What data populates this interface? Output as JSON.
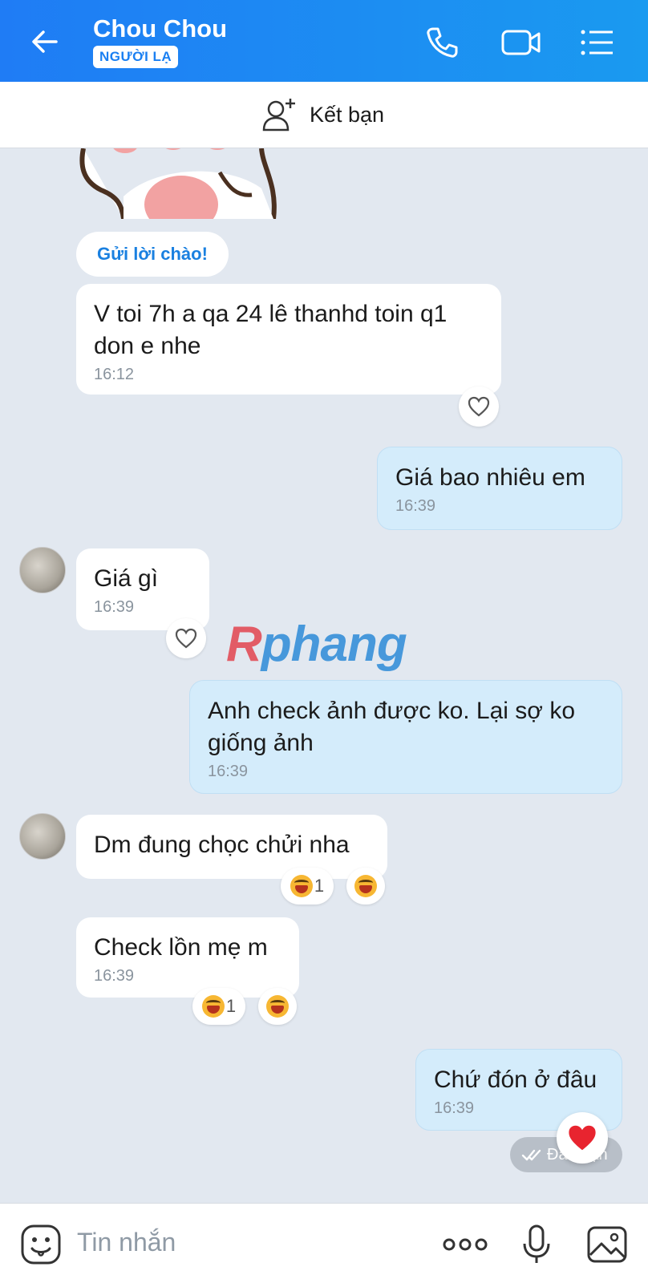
{
  "header": {
    "title": "Chou Chou",
    "badge": "NGƯỜI LẠ"
  },
  "add_friend": {
    "label": "Kết bạn"
  },
  "greeting_button": "Gửi lời chào!",
  "messages": [
    {
      "dir": "in",
      "text": "V toi 7h a qa 24 lê thanhd toin q1 don e nhe",
      "time": "16:12"
    },
    {
      "dir": "out",
      "text": "Giá bao nhiêu em",
      "time": "16:39"
    },
    {
      "dir": "in",
      "text": "Giá gì",
      "time": "16:39"
    },
    {
      "dir": "out",
      "text": "Anh check ảnh được ko. Lại sợ ko giống ảnh",
      "time": "16:39"
    },
    {
      "dir": "in",
      "text": "Dm đung chọc chửi nha",
      "time": "",
      "reaction_count": "1"
    },
    {
      "dir": "in",
      "text": "Check lồn mẹ m",
      "time": "16:39",
      "reaction_count": "1"
    },
    {
      "dir": "out",
      "text": "Chứ đón ở đâu",
      "time": "16:39"
    }
  ],
  "status": "Đã nhận",
  "watermark": {
    "r": "R",
    "rest": "phang"
  },
  "composer": {
    "placeholder": "Tin nhắn"
  },
  "colors": {
    "header": "#1f7cf5",
    "out_bubble": "#d4ecfb",
    "background": "#e2e8f0"
  }
}
